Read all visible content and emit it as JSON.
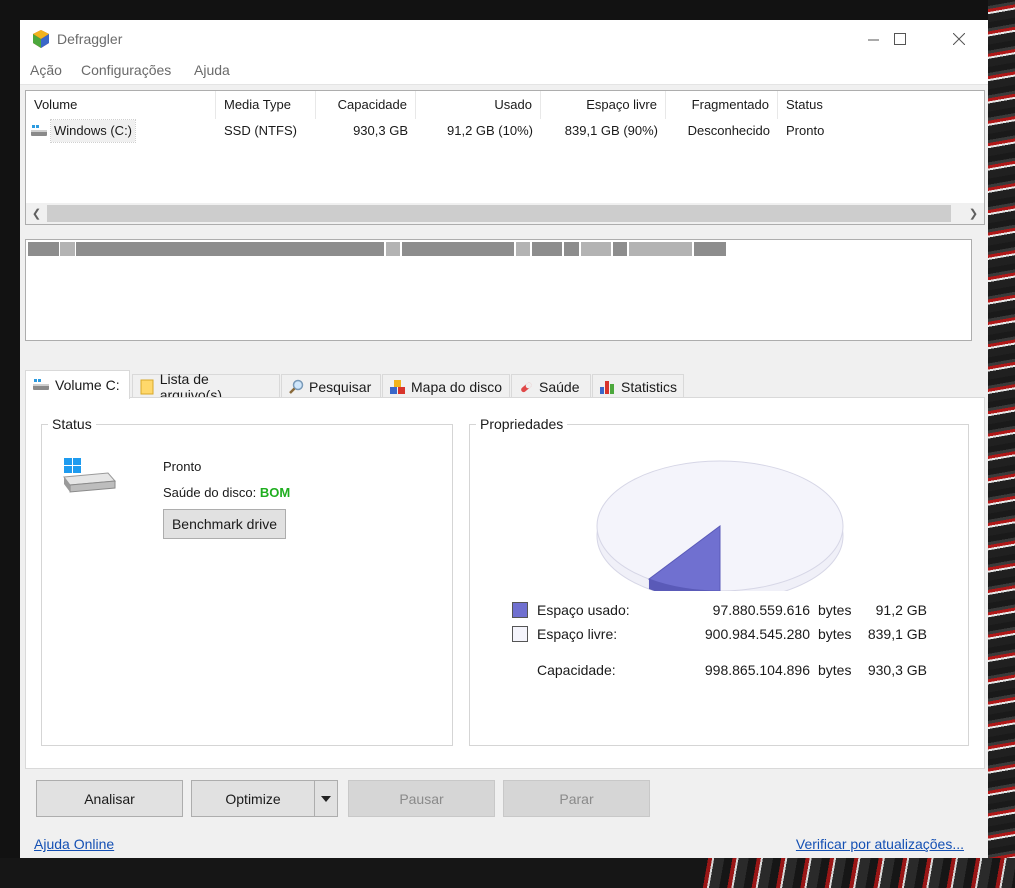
{
  "window": {
    "title": "Defraggler"
  },
  "menu": [
    "Ação",
    "Configurações",
    "Ajuda"
  ],
  "drive_table": {
    "columns": [
      "Volume",
      "Media Type",
      "Capacidade",
      "Usado",
      "Espaço livre",
      "Fragmentado",
      "Status"
    ],
    "rows": [
      {
        "volume": "Windows (C:)",
        "media_type": "SSD (NTFS)",
        "capacity": "930,3 GB",
        "used": "91,2 GB (10%)",
        "free": "839,1 GB (90%)",
        "fragmented": "Desconhecido",
        "status": "Pronto"
      }
    ]
  },
  "tabs": [
    {
      "label": "Volume C:",
      "icon": "drive-icon",
      "active": true
    },
    {
      "label": "Lista de arquivo(s)",
      "icon": "folder-icon"
    },
    {
      "label": "Pesquisar",
      "icon": "search-icon"
    },
    {
      "label": "Mapa do disco",
      "icon": "disk-map-icon"
    },
    {
      "label": "Saúde",
      "icon": "health-icon"
    },
    {
      "label": "Statistics",
      "icon": "statistics-icon"
    }
  ],
  "status_panel": {
    "title": "Status",
    "state": "Pronto",
    "health_label": "Saúde do disco:",
    "health_value": "BOM",
    "health_color": "#1fae1f",
    "benchmark_button": "Benchmark drive"
  },
  "properties_panel": {
    "title": "Propriedades",
    "used_label": "Espaço usado:",
    "used_bytes": "97.880.559.616",
    "used_gb": "91,2 GB",
    "free_label": "Espaço livre:",
    "free_bytes": "900.984.545.280",
    "free_gb": "839,1 GB",
    "capacity_label": "Capacidade:",
    "capacity_bytes": "998.865.104.896",
    "capacity_gb": "930,3 GB",
    "bytes_unit": "bytes",
    "used_fraction": 0.098,
    "used_color": "#7070d0",
    "free_color": "#f4f4fb"
  },
  "actions": {
    "analyze": "Analisar",
    "optimize": "Optimize",
    "pause": "Pausar",
    "stop": "Parar"
  },
  "links": {
    "help": "Ajuda Online",
    "updates": "Verificar por atualizações..."
  }
}
